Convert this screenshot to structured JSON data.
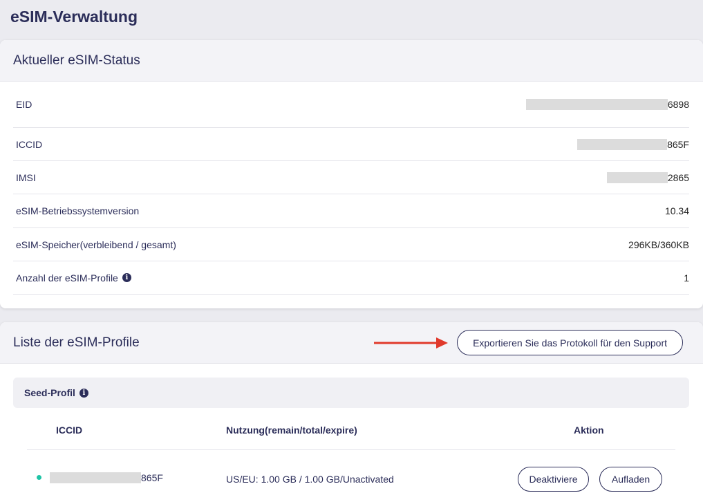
{
  "page": {
    "title": "eSIM-Verwaltung"
  },
  "status": {
    "title": "Aktueller eSIM-Status",
    "rows": [
      {
        "label": "EID",
        "value": "6898"
      },
      {
        "label": "ICCID",
        "value": "865F"
      },
      {
        "label": "IMSI",
        "value": "2865"
      },
      {
        "label": "eSIM-Betriebssystemversion",
        "value": "10.34"
      },
      {
        "label": "eSIM-Speicher(verbleibend / gesamt)",
        "value": "296KB/360KB"
      },
      {
        "label": "Anzahl der eSIM-Profile",
        "value": "1"
      }
    ]
  },
  "profiles": {
    "title": "Liste der eSIM-Profile",
    "export_label": "Exportieren Sie das Protokoll für den Support",
    "seed_label": "Seed-Profil",
    "columns": {
      "iccid": "ICCID",
      "usage": "Nutzung(remain/total/expire)",
      "action": "Aktion"
    },
    "row": {
      "iccid": "865F",
      "usage": "US/EU: 1.00 GB / 1.00 GB/Unactivated",
      "deactivate_label": "Deaktiviere",
      "recharge_label": "Aufladen",
      "status_color": "#1fc4a6"
    }
  },
  "colors": {
    "primary": "#2b2d59",
    "accent_arrow": "#e0392b",
    "active_dot": "#1fc4a6"
  },
  "icons": {
    "info": "info-icon",
    "arrow": "arrow-right-icon"
  }
}
